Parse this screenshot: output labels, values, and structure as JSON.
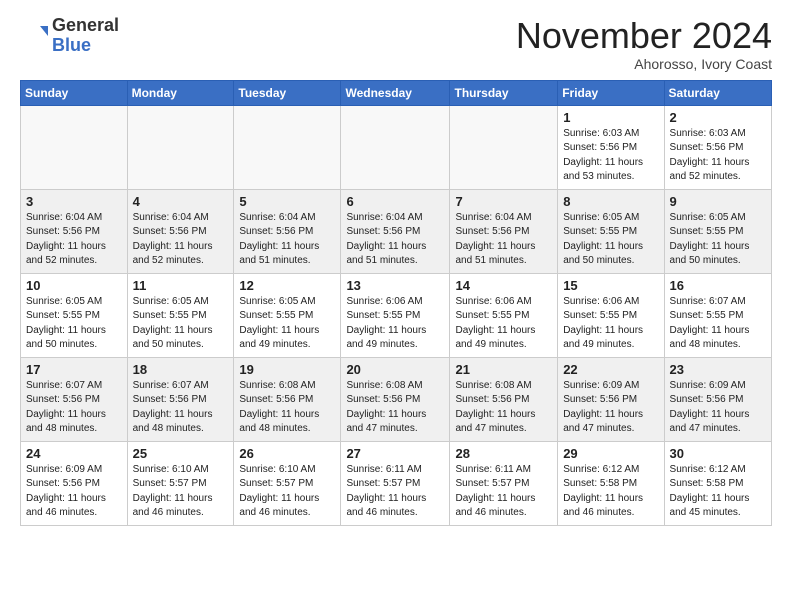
{
  "header": {
    "logo_general": "General",
    "logo_blue": "Blue",
    "month_title": "November 2024",
    "location": "Ahorosso, Ivory Coast"
  },
  "calendar": {
    "days_of_week": [
      "Sunday",
      "Monday",
      "Tuesday",
      "Wednesday",
      "Thursday",
      "Friday",
      "Saturday"
    ],
    "weeks": [
      [
        {
          "day": "",
          "info": ""
        },
        {
          "day": "",
          "info": ""
        },
        {
          "day": "",
          "info": ""
        },
        {
          "day": "",
          "info": ""
        },
        {
          "day": "",
          "info": ""
        },
        {
          "day": "1",
          "info": "Sunrise: 6:03 AM\nSunset: 5:56 PM\nDaylight: 11 hours\nand 53 minutes."
        },
        {
          "day": "2",
          "info": "Sunrise: 6:03 AM\nSunset: 5:56 PM\nDaylight: 11 hours\nand 52 minutes."
        }
      ],
      [
        {
          "day": "3",
          "info": "Sunrise: 6:04 AM\nSunset: 5:56 PM\nDaylight: 11 hours\nand 52 minutes."
        },
        {
          "day": "4",
          "info": "Sunrise: 6:04 AM\nSunset: 5:56 PM\nDaylight: 11 hours\nand 52 minutes."
        },
        {
          "day": "5",
          "info": "Sunrise: 6:04 AM\nSunset: 5:56 PM\nDaylight: 11 hours\nand 51 minutes."
        },
        {
          "day": "6",
          "info": "Sunrise: 6:04 AM\nSunset: 5:56 PM\nDaylight: 11 hours\nand 51 minutes."
        },
        {
          "day": "7",
          "info": "Sunrise: 6:04 AM\nSunset: 5:56 PM\nDaylight: 11 hours\nand 51 minutes."
        },
        {
          "day": "8",
          "info": "Sunrise: 6:05 AM\nSunset: 5:55 PM\nDaylight: 11 hours\nand 50 minutes."
        },
        {
          "day": "9",
          "info": "Sunrise: 6:05 AM\nSunset: 5:55 PM\nDaylight: 11 hours\nand 50 minutes."
        }
      ],
      [
        {
          "day": "10",
          "info": "Sunrise: 6:05 AM\nSunset: 5:55 PM\nDaylight: 11 hours\nand 50 minutes."
        },
        {
          "day": "11",
          "info": "Sunrise: 6:05 AM\nSunset: 5:55 PM\nDaylight: 11 hours\nand 50 minutes."
        },
        {
          "day": "12",
          "info": "Sunrise: 6:05 AM\nSunset: 5:55 PM\nDaylight: 11 hours\nand 49 minutes."
        },
        {
          "day": "13",
          "info": "Sunrise: 6:06 AM\nSunset: 5:55 PM\nDaylight: 11 hours\nand 49 minutes."
        },
        {
          "day": "14",
          "info": "Sunrise: 6:06 AM\nSunset: 5:55 PM\nDaylight: 11 hours\nand 49 minutes."
        },
        {
          "day": "15",
          "info": "Sunrise: 6:06 AM\nSunset: 5:55 PM\nDaylight: 11 hours\nand 49 minutes."
        },
        {
          "day": "16",
          "info": "Sunrise: 6:07 AM\nSunset: 5:55 PM\nDaylight: 11 hours\nand 48 minutes."
        }
      ],
      [
        {
          "day": "17",
          "info": "Sunrise: 6:07 AM\nSunset: 5:56 PM\nDaylight: 11 hours\nand 48 minutes."
        },
        {
          "day": "18",
          "info": "Sunrise: 6:07 AM\nSunset: 5:56 PM\nDaylight: 11 hours\nand 48 minutes."
        },
        {
          "day": "19",
          "info": "Sunrise: 6:08 AM\nSunset: 5:56 PM\nDaylight: 11 hours\nand 48 minutes."
        },
        {
          "day": "20",
          "info": "Sunrise: 6:08 AM\nSunset: 5:56 PM\nDaylight: 11 hours\nand 47 minutes."
        },
        {
          "day": "21",
          "info": "Sunrise: 6:08 AM\nSunset: 5:56 PM\nDaylight: 11 hours\nand 47 minutes."
        },
        {
          "day": "22",
          "info": "Sunrise: 6:09 AM\nSunset: 5:56 PM\nDaylight: 11 hours\nand 47 minutes."
        },
        {
          "day": "23",
          "info": "Sunrise: 6:09 AM\nSunset: 5:56 PM\nDaylight: 11 hours\nand 47 minutes."
        }
      ],
      [
        {
          "day": "24",
          "info": "Sunrise: 6:09 AM\nSunset: 5:56 PM\nDaylight: 11 hours\nand 46 minutes."
        },
        {
          "day": "25",
          "info": "Sunrise: 6:10 AM\nSunset: 5:57 PM\nDaylight: 11 hours\nand 46 minutes."
        },
        {
          "day": "26",
          "info": "Sunrise: 6:10 AM\nSunset: 5:57 PM\nDaylight: 11 hours\nand 46 minutes."
        },
        {
          "day": "27",
          "info": "Sunrise: 6:11 AM\nSunset: 5:57 PM\nDaylight: 11 hours\nand 46 minutes."
        },
        {
          "day": "28",
          "info": "Sunrise: 6:11 AM\nSunset: 5:57 PM\nDaylight: 11 hours\nand 46 minutes."
        },
        {
          "day": "29",
          "info": "Sunrise: 6:12 AM\nSunset: 5:58 PM\nDaylight: 11 hours\nand 46 minutes."
        },
        {
          "day": "30",
          "info": "Sunrise: 6:12 AM\nSunset: 5:58 PM\nDaylight: 11 hours\nand 45 minutes."
        }
      ]
    ]
  }
}
